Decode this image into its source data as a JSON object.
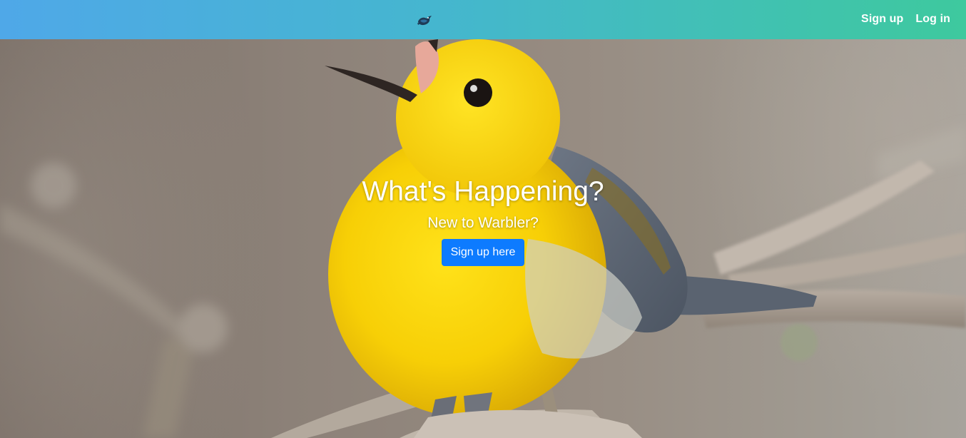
{
  "navbar": {
    "brand_icon": "warbler-bird-logo-icon",
    "links": [
      {
        "label": "Sign up"
      },
      {
        "label": "Log in"
      }
    ],
    "gradient_colors": [
      "#4fa8e8",
      "#3ec99e"
    ]
  },
  "hero": {
    "title": "What's Happening?",
    "subtitle": "New to Warbler?",
    "cta_label": "Sign up here",
    "cta_color": "#0d7bff",
    "background_image": "yellow-warbler-photo"
  }
}
